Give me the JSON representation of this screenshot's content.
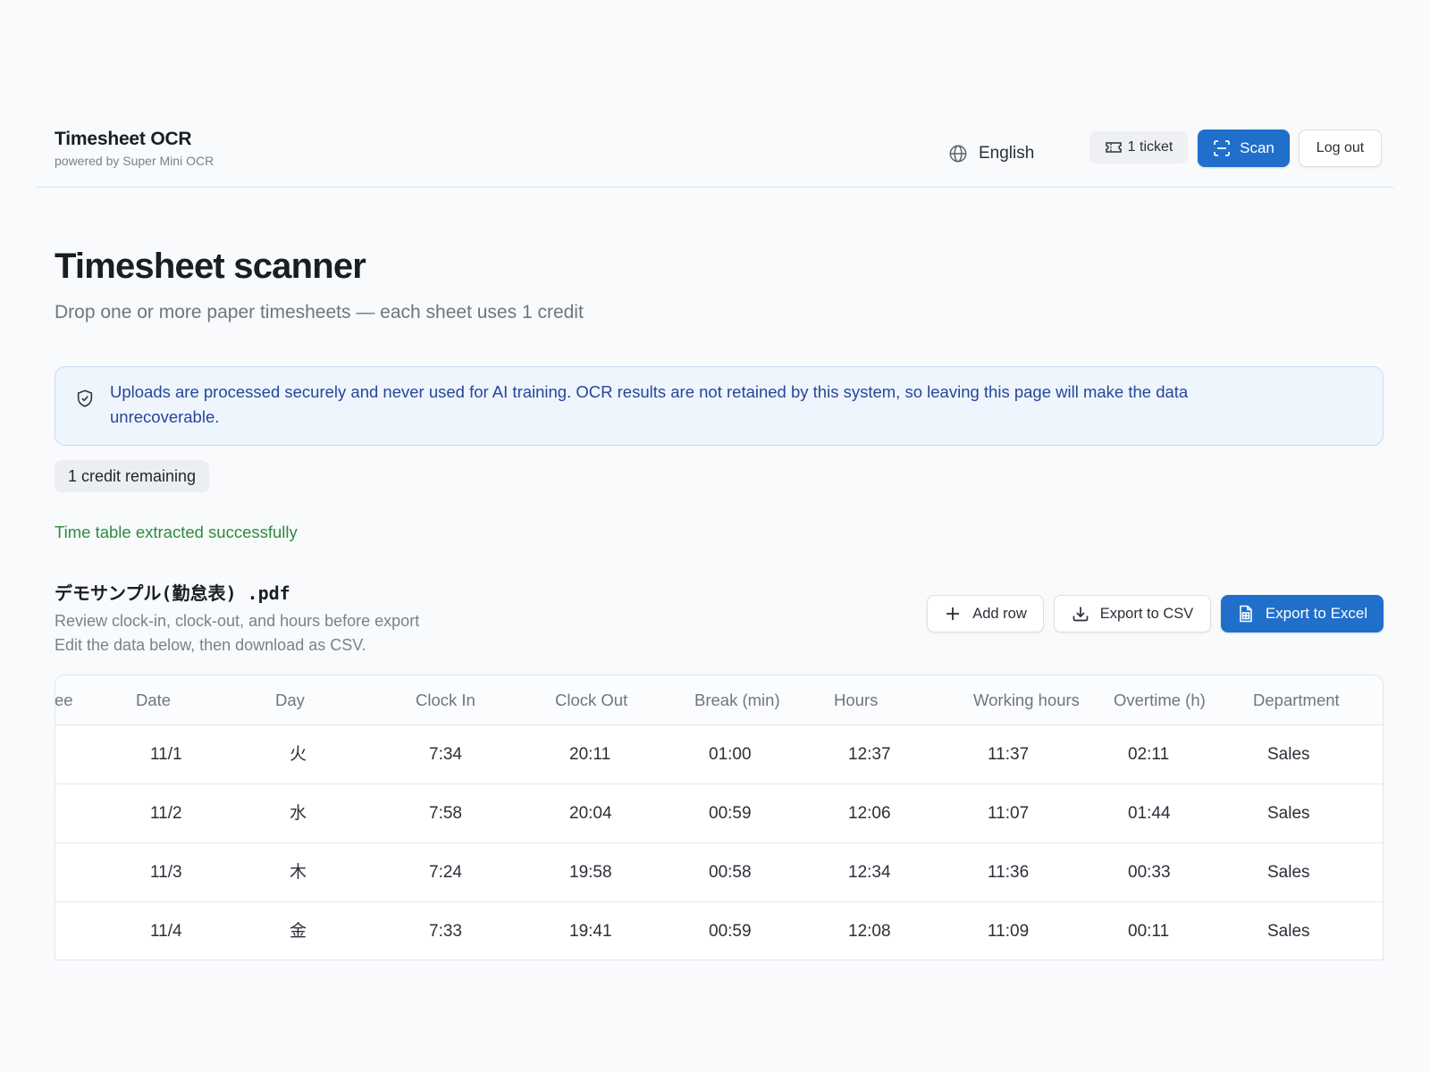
{
  "header": {
    "brand_title": "Timesheet OCR",
    "brand_subtitle": "powered by Super Mini OCR",
    "language": "English",
    "tickets": "1 ticket",
    "scan_label": "Scan",
    "logout_label": "Log out"
  },
  "hero": {
    "title": "Timesheet scanner",
    "subtitle": "Drop one or more paper timesheets — each sheet uses 1 credit"
  },
  "notice": {
    "text": "Uploads are processed securely and never used for AI training. OCR results are not retained by this system, so leaving this page will make the data unrecoverable."
  },
  "credits_badge": "1 credit remaining",
  "status_message": "Time table extracted successfully",
  "file": {
    "name": "デモサンプル(勤怠表) .pdf",
    "desc_line1": "Review clock-in, clock-out, and hours before export",
    "desc_line2": "Edit the data below, then download as CSV."
  },
  "actions": {
    "add_row": "Add row",
    "export_csv": "Export to CSV",
    "export_excel": "Export to Excel"
  },
  "table": {
    "headers": [
      "ee",
      "Date",
      "Day",
      "Clock In",
      "Clock Out",
      "Break (min)",
      "Hours",
      "Working hours",
      "Overtime (h)",
      "Department"
    ],
    "rows": [
      [
        "11/1",
        "火",
        "7:34",
        "20:11",
        "01:00",
        "12:37",
        "11:37",
        "02:11",
        "Sales"
      ],
      [
        "11/2",
        "水",
        "7:58",
        "20:04",
        "00:59",
        "12:06",
        "11:07",
        "01:44",
        "Sales"
      ],
      [
        "11/3",
        "木",
        "7:24",
        "19:58",
        "00:58",
        "12:34",
        "11:36",
        "00:33",
        "Sales"
      ],
      [
        "11/4",
        "金",
        "7:33",
        "19:41",
        "00:59",
        "12:08",
        "11:09",
        "00:11",
        "Sales"
      ]
    ]
  },
  "colors": {
    "accent": "#1f6fcb",
    "success": "#2f8a3e",
    "notice_bg": "#eef5fd",
    "notice_text": "#26469a"
  },
  "icons": {
    "language": "globe-icon",
    "ticket": "ticket-icon",
    "scan": "scan-icon",
    "notice": "shield-check-icon",
    "add_row": "plus-icon",
    "export_csv": "download-icon",
    "export_excel": "spreadsheet-file-icon"
  }
}
